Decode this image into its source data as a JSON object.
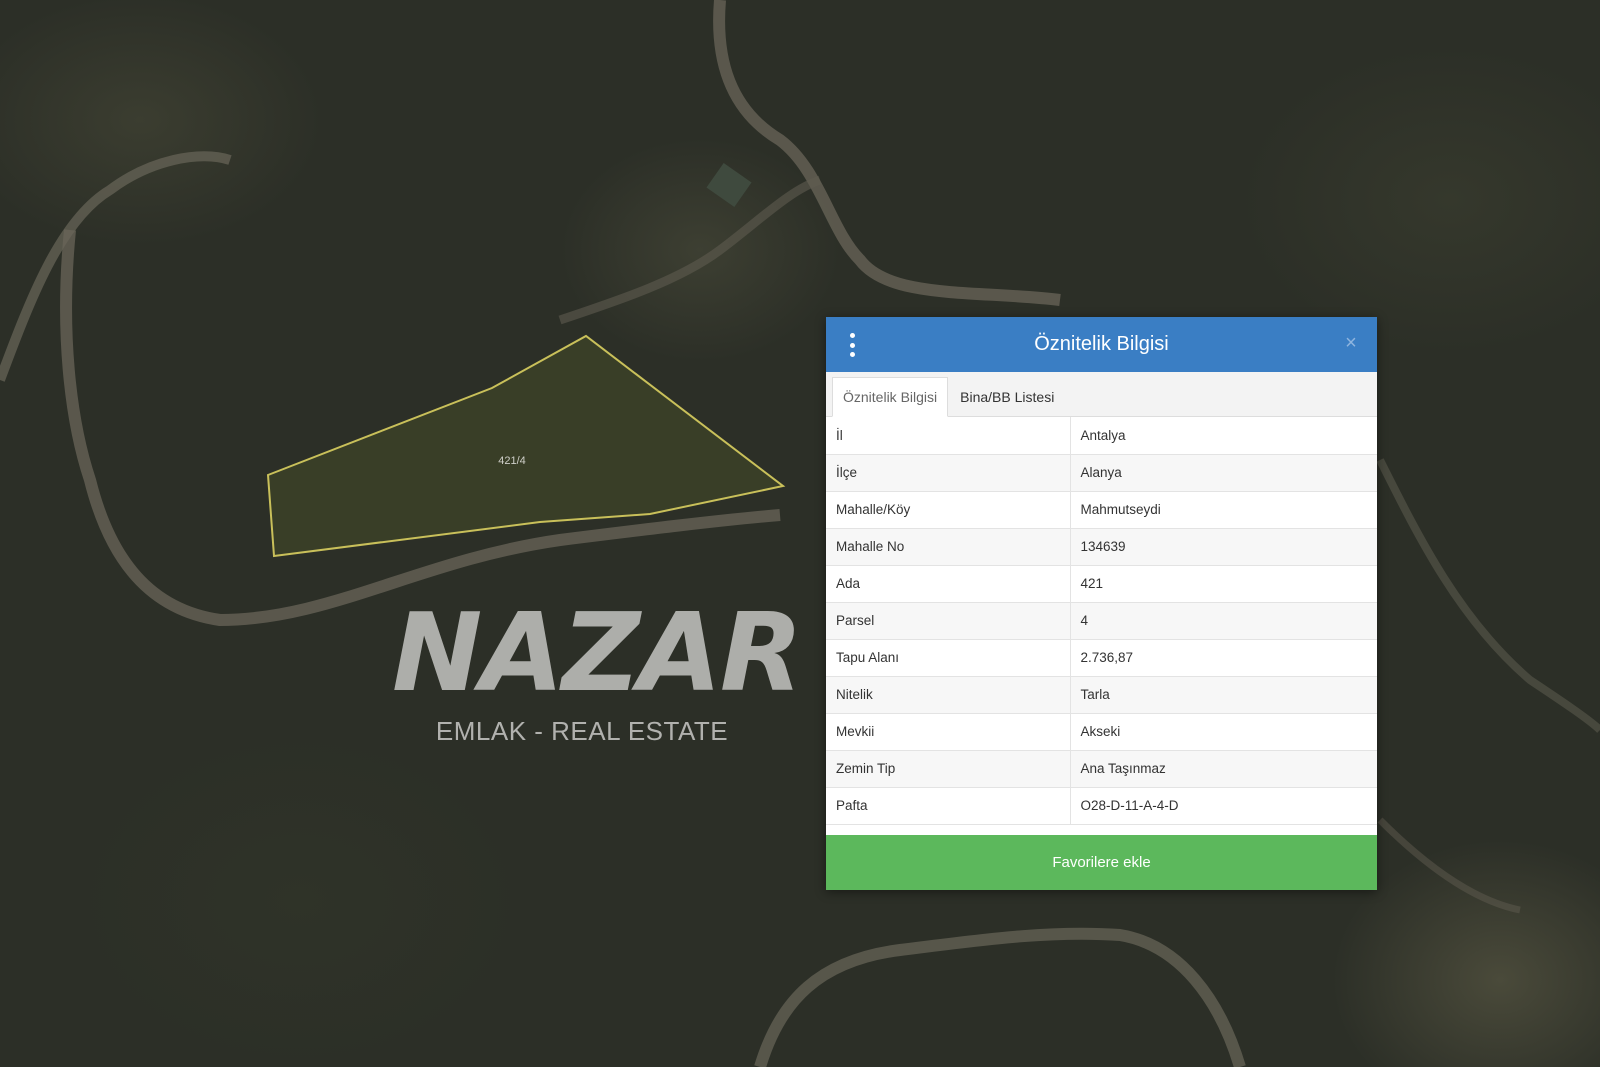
{
  "map": {
    "parcel_label": "421/4"
  },
  "watermark": {
    "brand": "NAZAR",
    "subtitle": "EMLAK - REAL ESTATE"
  },
  "panel": {
    "title": "Öznitelik Bilgisi",
    "menu_icon": "vertical-ellipsis-icon",
    "close_icon": "close-icon",
    "close_glyph": "×",
    "tabs": [
      {
        "label": "Öznitelik Bilgisi",
        "active": true
      },
      {
        "label": "Bina/BB Listesi",
        "active": false
      }
    ],
    "rows": [
      {
        "key": "İl",
        "value": "Antalya"
      },
      {
        "key": "İlçe",
        "value": "Alanya"
      },
      {
        "key": "Mahalle/Köy",
        "value": "Mahmutseydi"
      },
      {
        "key": "Mahalle No",
        "value": "134639"
      },
      {
        "key": "Ada",
        "value": "421"
      },
      {
        "key": "Parsel",
        "value": "4"
      },
      {
        "key": "Tapu Alanı",
        "value": "2.736,87"
      },
      {
        "key": "Nitelik",
        "value": "Tarla"
      },
      {
        "key": "Mevkii",
        "value": "Akseki"
      },
      {
        "key": "Zemin Tip",
        "value": "Ana Taşınmaz"
      },
      {
        "key": "Pafta",
        "value": "O28-D-11-A-4-D"
      }
    ],
    "favorite_button": "Favorilere ekle"
  },
  "colors": {
    "header": "#3a7ec4",
    "button": "#5cb85c",
    "parcel_outline": "#c9c05a"
  }
}
